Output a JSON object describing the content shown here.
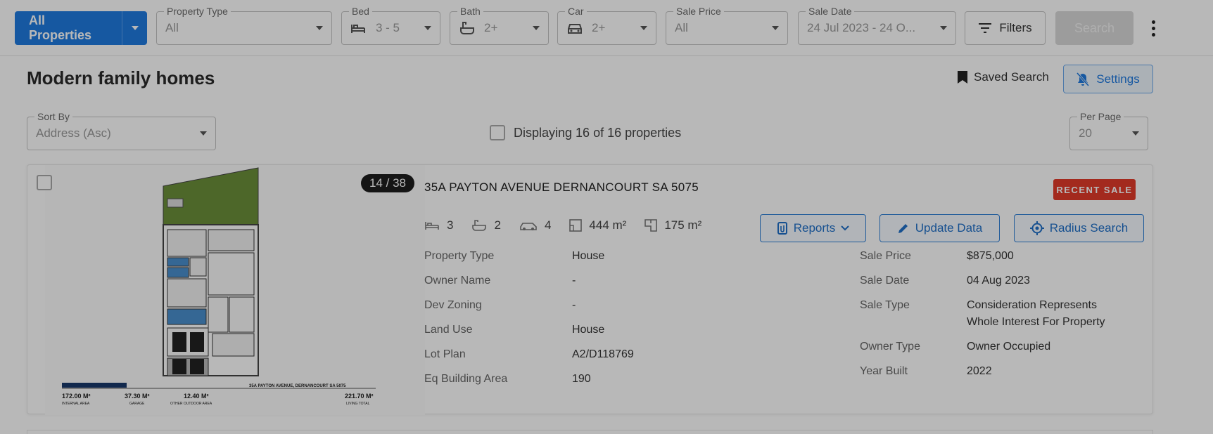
{
  "topbar": {
    "scope_button": "All Properties",
    "filters": [
      {
        "name": "property-type",
        "label": "Property Type",
        "value": "All"
      },
      {
        "name": "bed",
        "label": "Bed",
        "value": "3 - 5"
      },
      {
        "name": "bath",
        "label": "Bath",
        "value": "2+"
      },
      {
        "name": "car",
        "label": "Car",
        "value": "2+"
      },
      {
        "name": "sale-price",
        "label": "Sale Price",
        "value": "All"
      },
      {
        "name": "sale-date",
        "label": "Sale Date",
        "value": "24 Jul 2023 - 24 O..."
      }
    ],
    "filters_button": "Filters",
    "search_button": "Search"
  },
  "header": {
    "title": "Modern family homes",
    "saved_search": "Saved Search",
    "settings": "Settings"
  },
  "toolbar": {
    "sort_label": "Sort By",
    "sort_value": "Address (Asc)",
    "displaying": "Displaying 16 of 16 properties",
    "per_page_label": "Per Page",
    "per_page_value": "20"
  },
  "card": {
    "image_counter": "14 / 38",
    "address": "35A PAYTON AVENUE DERNANCOURT SA 5075",
    "badge": "RECENT SALE",
    "features": {
      "beds": "3",
      "baths": "2",
      "cars": "4",
      "land_area": "444 m²",
      "floor_area": "175 m²"
    },
    "actions": {
      "reports": "Reports",
      "update": "Update Data",
      "radius": "Radius Search"
    },
    "details_left": [
      {
        "label": "Property Type",
        "value": "House"
      },
      {
        "label": "Owner Name",
        "value": "-"
      },
      {
        "label": "Dev Zoning",
        "value": "-"
      },
      {
        "label": "Land Use",
        "value": "House"
      },
      {
        "label": "Lot Plan",
        "value": "A2/D118769"
      },
      {
        "label": "Eq Building Area",
        "value": "190"
      }
    ],
    "details_right": [
      {
        "label": "Sale Price",
        "value": "$875,000"
      },
      {
        "label": "Sale Date",
        "value": "04 Aug 2023"
      },
      {
        "label": "Sale Type",
        "value": "Consideration Represents Whole Interest For Property"
      },
      {
        "label": "Owner Type",
        "value": "Owner Occupied"
      },
      {
        "label": "Year Built",
        "value": "2022"
      }
    ],
    "floorplan": {
      "address": "35A PAYTON AVENUE, DERNANCOURT SA 5075",
      "internal": "172.00 M²",
      "internal_label": "INTERNAL AREA",
      "garage": "37.30 M²",
      "garage_label": "GARAGE",
      "outdoor": "12.40 M²",
      "outdoor_label": "OTHER OUTDOOR AREA",
      "total": "221.70 M²",
      "total_label": "LIVING TOTAL"
    }
  },
  "colors": {
    "primary": "#1f7ae0",
    "badge": "#e23b2a"
  }
}
